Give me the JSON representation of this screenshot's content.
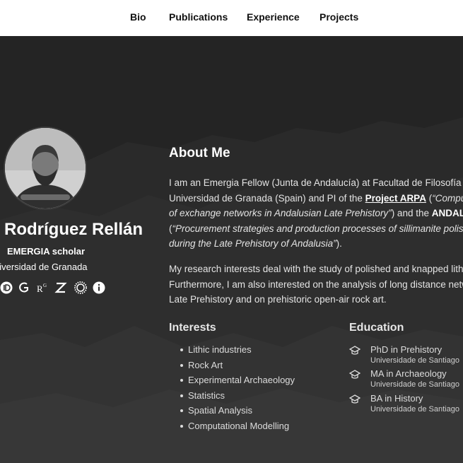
{
  "nav": {
    "items": [
      {
        "label": "Bio"
      },
      {
        "label": "Publications"
      },
      {
        "label": "Experience"
      },
      {
        "label": "Projects"
      }
    ]
  },
  "profile": {
    "name": "Rodríguez Rellán",
    "role": "EMERGIA scholar",
    "affiliation": "niversidad de Granada",
    "social_icons": [
      "orcid-icon",
      "google-scholar-icon",
      "researchgate-icon",
      "zenodo-icon",
      "sun-icon",
      "info-icon"
    ]
  },
  "about": {
    "title": "About Me",
    "p1": {
      "l1": "I am an Emergia Fellow (Junta de Andalucía) at Facultad de Filosofía y Le",
      "l2_a": "Universidad de Granada (Spain) and PI of the ",
      "l2_link": "Project ARPA",
      "l2_b": " (",
      "l2_em": "“Computati",
      "l3_em": "of exchange networks in Andalusian Late Prehistory”",
      "l3_b": ") and the ",
      "l3_strong": "ANDALUS",
      "l4_a": "(",
      "l4_em": "“Procurement strategies and production processes of sillimanite polishe",
      "l5_em": "during the Late Prehistory of Andalusia”",
      "l5_b": ")."
    },
    "p2": {
      "l1": "My research interests deal with the study of polished and knapped lithic",
      "l2": "Furthermore, I am also interested on the analysis of long distance netwo",
      "l3": "Late Prehistory and on prehistoric open-air rock art."
    }
  },
  "interests": {
    "title": "Interests",
    "items": [
      "Lithic industries",
      "Rock Art",
      "Experimental Archaeology",
      "Statistics",
      "Spatial Analysis",
      "Computational Modelling"
    ]
  },
  "education": {
    "title": "Education",
    "items": [
      {
        "degree": "PhD in Prehistory",
        "institution": "Universidade de Santiago"
      },
      {
        "degree": "MA in Archaeology",
        "institution": "Universidade de Santiago"
      },
      {
        "degree": "BA in History",
        "institution": "Universidade de Santiago"
      }
    ]
  },
  "colors": {
    "background": "#262626",
    "navbar": "#ffffff",
    "text": "#e6e6e6"
  }
}
